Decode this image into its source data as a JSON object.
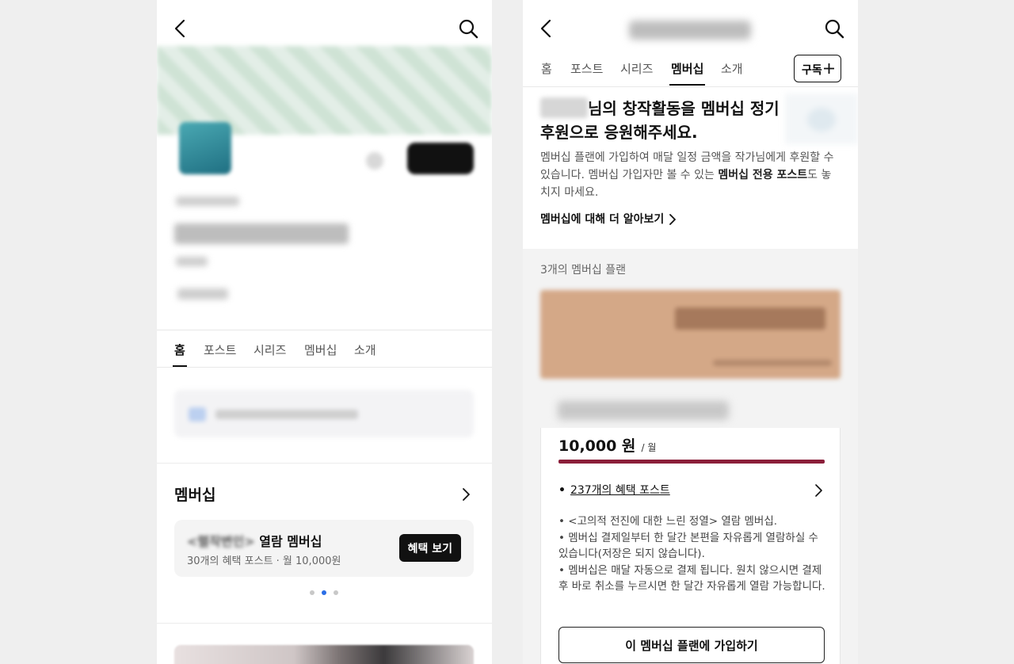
{
  "left": {
    "tabs": [
      "홈",
      "포스트",
      "시리즈",
      "멤버십",
      "소개"
    ],
    "membership_section": {
      "title": "멤버십",
      "card": {
        "title_blurred_part": "<렬작변인>",
        "title_suffix": " 열람 멤버십",
        "subtitle": "30개의 혜택 포스트 · 월 10,000원",
        "button": "혜택 보기"
      },
      "carousel": {
        "count": 3,
        "active_index": 1
      }
    }
  },
  "right": {
    "tabs": [
      "홈",
      "포스트",
      "시리즈",
      "멤버십",
      "소개"
    ],
    "subscribe_button": "구독",
    "headline_part1": "님의 창작활동을 멤버십 정기",
    "headline_part2": "후원으로 응원해주세요.",
    "description_before": "멤버십 플랜에 가입하여 매달 일정 금액을 작가님에게 후원할 수 있습니다. 멤버십 가입자만 볼 수 있는 ",
    "description_bold": "멤버십 전용 포스트",
    "description_after": "도 놓치지 마세요.",
    "learn_more": "멤버십에 대해 더 알아보기",
    "plan_count": "3개의 멤버십 플랜",
    "plan": {
      "price": "10,000 원",
      "period": "/ 월",
      "benefit_bullet": "•",
      "benefit_link": "237개의 혜택 포스트",
      "desc_lines": [
        "• <고의적 전진에 대한 느린 정열> 열람 멤버십.",
        "• 멤버십 결제일부터 한 달간 본편을 자유롭게 열람하실 수 있습니다(저장은 되지 않습니다).",
        "• 멤버십은 매달 자동으로 결제 됩니다. 원치 않으시면 결제 후 바로 취소를 누르시면 한 달간 자유롭게 열람 가능합니다."
      ],
      "join_button": "이 멤버십 플랜에 가입하기"
    }
  },
  "colors": {
    "accent_bar": "#8b1f3a",
    "dot_active": "#2b6ee6"
  }
}
